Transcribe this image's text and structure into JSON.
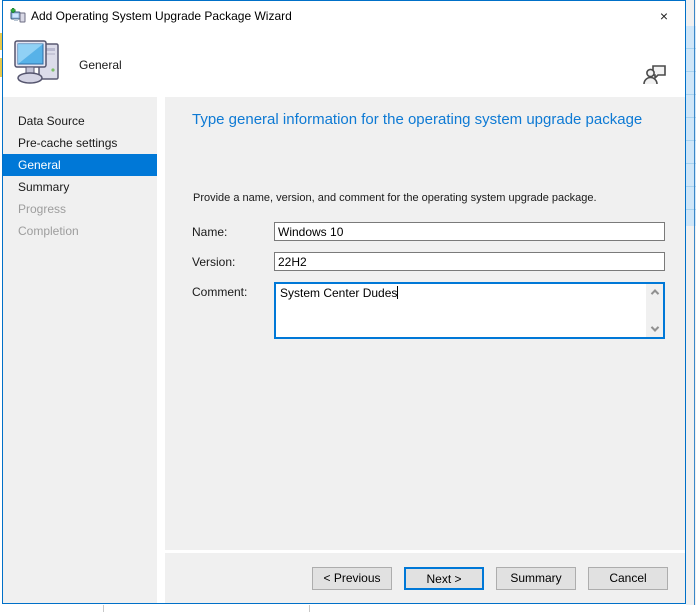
{
  "window": {
    "title": "Add Operating System Upgrade Package Wizard",
    "icons": {
      "titlebar": "computer-with-green-plus",
      "close": "×",
      "header_step": "desktop-computer",
      "header_right": "person-with-speech-bubble"
    },
    "colors": {
      "accent": "#0078d7",
      "window_border": "#0070c8",
      "heading_text": "#0e7ad4",
      "body_background": "#f0f0f0",
      "disabled_text": "#9d9d9d",
      "button_face": "#e1e1e1"
    }
  },
  "header": {
    "step_title": "General"
  },
  "sidebar": {
    "items": [
      {
        "label": "Data Source",
        "state": "enabled"
      },
      {
        "label": "Pre-cache settings",
        "state": "enabled"
      },
      {
        "label": "General",
        "state": "selected"
      },
      {
        "label": "Summary",
        "state": "enabled"
      },
      {
        "label": "Progress",
        "state": "disabled"
      },
      {
        "label": "Completion",
        "state": "disabled"
      }
    ]
  },
  "content": {
    "heading": "Type general information for the operating system upgrade package",
    "instruction": "Provide a name, version, and comment for the operating system upgrade package.",
    "fields": {
      "name": {
        "label": "Name:",
        "value": "Windows 10"
      },
      "version": {
        "label": "Version:",
        "value": "22H2"
      },
      "comment": {
        "label": "Comment:",
        "value": "System Center Dudes"
      }
    }
  },
  "footer": {
    "buttons": [
      {
        "label": "< Previous",
        "default": false
      },
      {
        "label": "Next >",
        "default": true
      },
      {
        "label": "Summary",
        "default": false
      },
      {
        "label": "Cancel",
        "default": false
      }
    ]
  }
}
